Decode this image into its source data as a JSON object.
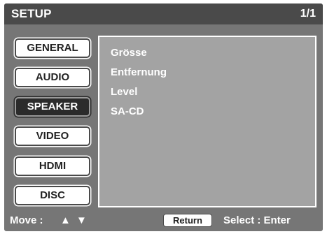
{
  "header": {
    "title": "SETUP",
    "page_indicator": "1/1"
  },
  "tabs": [
    {
      "label": "GENERAL",
      "active": false
    },
    {
      "label": "AUDIO",
      "active": false
    },
    {
      "label": "SPEAKER",
      "active": true
    },
    {
      "label": "VIDEO",
      "active": false
    },
    {
      "label": "HDMI",
      "active": false
    },
    {
      "label": "DISC",
      "active": false
    }
  ],
  "content": {
    "items": [
      "Grösse",
      "Entfernung",
      "Level",
      "SA-CD"
    ]
  },
  "footer": {
    "move_label": "Move :",
    "up_arrow": "▲",
    "down_arrow": "▼",
    "return_label": "Return",
    "select_label": "Select :  Enter"
  },
  "colors": {
    "background": "#767676",
    "title_bar": "#4a4a4a",
    "content_panel": "#a3a3a3",
    "active_tab": "#2b2b2b",
    "text": "#ffffff"
  }
}
